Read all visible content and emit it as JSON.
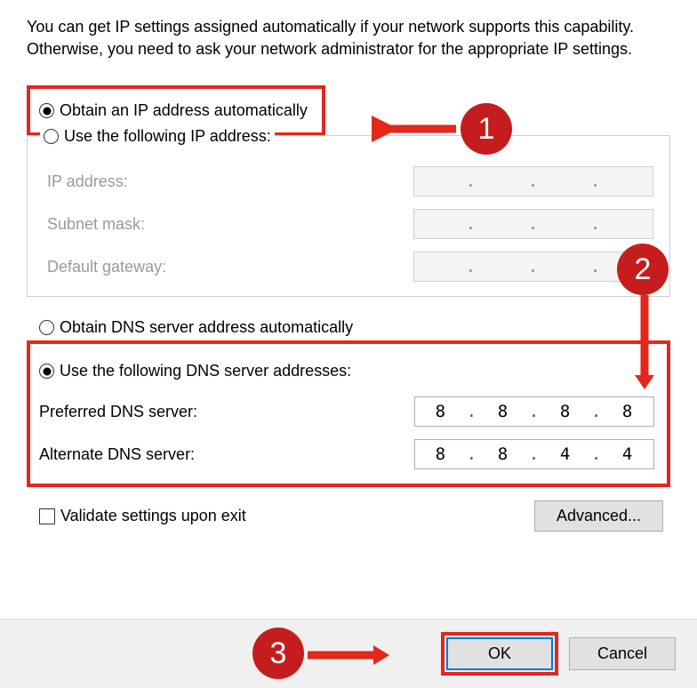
{
  "intro": "You can get IP settings assigned automatically if your network supports this capability. Otherwise, you need to ask your network administrator for the appropriate IP settings.",
  "ip": {
    "auto_label": "Obtain an IP address automatically",
    "manual_label": "Use the following IP address:",
    "fields": {
      "ip_address": "IP address:",
      "subnet_mask": "Subnet mask:",
      "default_gateway": "Default gateway:"
    }
  },
  "dns": {
    "auto_label": "Obtain DNS server address automatically",
    "manual_label": "Use the following DNS server addresses:",
    "preferred_label": "Preferred DNS server:",
    "alternate_label": "Alternate DNS server:",
    "preferred_value": [
      "8",
      "8",
      "8",
      "8"
    ],
    "alternate_value": [
      "8",
      "8",
      "4",
      "4"
    ]
  },
  "validate_label": "Validate settings upon exit",
  "advanced_label": "Advanced...",
  "ok_label": "OK",
  "cancel_label": "Cancel",
  "annotations": {
    "one": "1",
    "two": "2",
    "three": "3"
  }
}
